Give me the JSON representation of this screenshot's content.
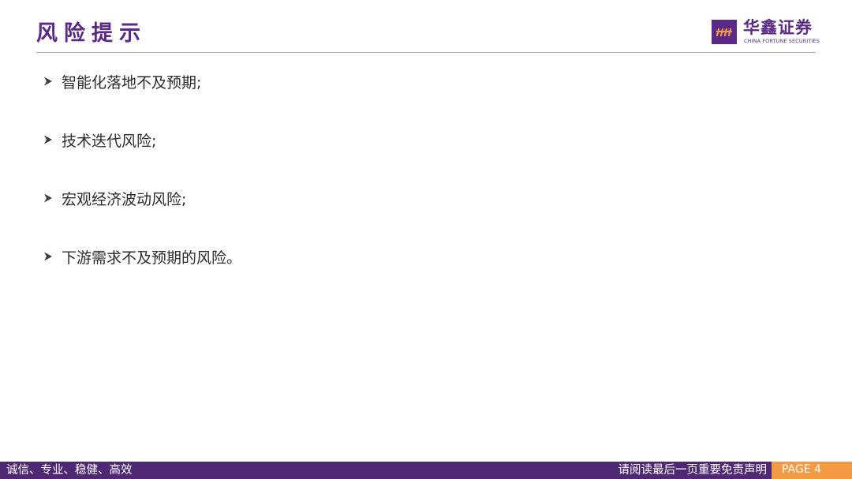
{
  "header": {
    "title": "风险提示"
  },
  "logo": {
    "name_cn": "华鑫证券",
    "name_en": "CHINA FORTUNE SECURITIES",
    "mark_icon": "brand-mark-icon"
  },
  "content": {
    "bullet_icon": "arrowhead-bullet-icon",
    "items": [
      {
        "text": "智能化落地不及预期;"
      },
      {
        "text": "技术迭代风险;"
      },
      {
        "text": "宏观经济波动风险;"
      },
      {
        "text": "下游需求不及预期的风险。"
      }
    ]
  },
  "footer": {
    "motto": "诚信、专业、稳健、高效",
    "disclaimer": "请阅读最后一页重要免责声明",
    "page_label": "PAGE 4"
  },
  "colors": {
    "brand_purple": "#5b2a86",
    "footer_purple": "#4f2873",
    "page_orange": "#f39a44",
    "body_text": "#2b2b2b"
  }
}
